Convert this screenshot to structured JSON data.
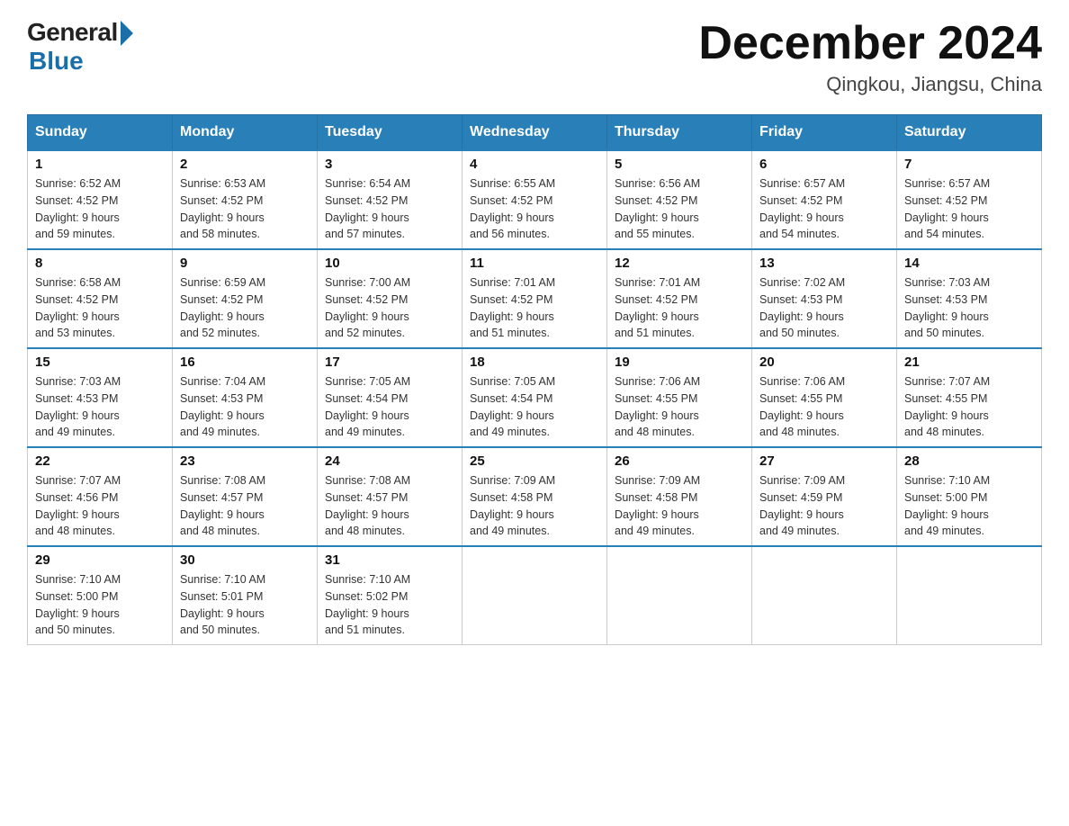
{
  "logo": {
    "general": "General",
    "blue": "Blue"
  },
  "title": "December 2024",
  "subtitle": "Qingkou, Jiangsu, China",
  "days": [
    "Sunday",
    "Monday",
    "Tuesday",
    "Wednesday",
    "Thursday",
    "Friday",
    "Saturday"
  ],
  "weeks": [
    [
      {
        "day": "1",
        "sunrise": "6:52 AM",
        "sunset": "4:52 PM",
        "daylight": "9 hours and 59 minutes."
      },
      {
        "day": "2",
        "sunrise": "6:53 AM",
        "sunset": "4:52 PM",
        "daylight": "9 hours and 58 minutes."
      },
      {
        "day": "3",
        "sunrise": "6:54 AM",
        "sunset": "4:52 PM",
        "daylight": "9 hours and 57 minutes."
      },
      {
        "day": "4",
        "sunrise": "6:55 AM",
        "sunset": "4:52 PM",
        "daylight": "9 hours and 56 minutes."
      },
      {
        "day": "5",
        "sunrise": "6:56 AM",
        "sunset": "4:52 PM",
        "daylight": "9 hours and 55 minutes."
      },
      {
        "day": "6",
        "sunrise": "6:57 AM",
        "sunset": "4:52 PM",
        "daylight": "9 hours and 54 minutes."
      },
      {
        "day": "7",
        "sunrise": "6:57 AM",
        "sunset": "4:52 PM",
        "daylight": "9 hours and 54 minutes."
      }
    ],
    [
      {
        "day": "8",
        "sunrise": "6:58 AM",
        "sunset": "4:52 PM",
        "daylight": "9 hours and 53 minutes."
      },
      {
        "day": "9",
        "sunrise": "6:59 AM",
        "sunset": "4:52 PM",
        "daylight": "9 hours and 52 minutes."
      },
      {
        "day": "10",
        "sunrise": "7:00 AM",
        "sunset": "4:52 PM",
        "daylight": "9 hours and 52 minutes."
      },
      {
        "day": "11",
        "sunrise": "7:01 AM",
        "sunset": "4:52 PM",
        "daylight": "9 hours and 51 minutes."
      },
      {
        "day": "12",
        "sunrise": "7:01 AM",
        "sunset": "4:52 PM",
        "daylight": "9 hours and 51 minutes."
      },
      {
        "day": "13",
        "sunrise": "7:02 AM",
        "sunset": "4:53 PM",
        "daylight": "9 hours and 50 minutes."
      },
      {
        "day": "14",
        "sunrise": "7:03 AM",
        "sunset": "4:53 PM",
        "daylight": "9 hours and 50 minutes."
      }
    ],
    [
      {
        "day": "15",
        "sunrise": "7:03 AM",
        "sunset": "4:53 PM",
        "daylight": "9 hours and 49 minutes."
      },
      {
        "day": "16",
        "sunrise": "7:04 AM",
        "sunset": "4:53 PM",
        "daylight": "9 hours and 49 minutes."
      },
      {
        "day": "17",
        "sunrise": "7:05 AM",
        "sunset": "4:54 PM",
        "daylight": "9 hours and 49 minutes."
      },
      {
        "day": "18",
        "sunrise": "7:05 AM",
        "sunset": "4:54 PM",
        "daylight": "9 hours and 49 minutes."
      },
      {
        "day": "19",
        "sunrise": "7:06 AM",
        "sunset": "4:55 PM",
        "daylight": "9 hours and 48 minutes."
      },
      {
        "day": "20",
        "sunrise": "7:06 AM",
        "sunset": "4:55 PM",
        "daylight": "9 hours and 48 minutes."
      },
      {
        "day": "21",
        "sunrise": "7:07 AM",
        "sunset": "4:55 PM",
        "daylight": "9 hours and 48 minutes."
      }
    ],
    [
      {
        "day": "22",
        "sunrise": "7:07 AM",
        "sunset": "4:56 PM",
        "daylight": "9 hours and 48 minutes."
      },
      {
        "day": "23",
        "sunrise": "7:08 AM",
        "sunset": "4:57 PM",
        "daylight": "9 hours and 48 minutes."
      },
      {
        "day": "24",
        "sunrise": "7:08 AM",
        "sunset": "4:57 PM",
        "daylight": "9 hours and 48 minutes."
      },
      {
        "day": "25",
        "sunrise": "7:09 AM",
        "sunset": "4:58 PM",
        "daylight": "9 hours and 49 minutes."
      },
      {
        "day": "26",
        "sunrise": "7:09 AM",
        "sunset": "4:58 PM",
        "daylight": "9 hours and 49 minutes."
      },
      {
        "day": "27",
        "sunrise": "7:09 AM",
        "sunset": "4:59 PM",
        "daylight": "9 hours and 49 minutes."
      },
      {
        "day": "28",
        "sunrise": "7:10 AM",
        "sunset": "5:00 PM",
        "daylight": "9 hours and 49 minutes."
      }
    ],
    [
      {
        "day": "29",
        "sunrise": "7:10 AM",
        "sunset": "5:00 PM",
        "daylight": "9 hours and 50 minutes."
      },
      {
        "day": "30",
        "sunrise": "7:10 AM",
        "sunset": "5:01 PM",
        "daylight": "9 hours and 50 minutes."
      },
      {
        "day": "31",
        "sunrise": "7:10 AM",
        "sunset": "5:02 PM",
        "daylight": "9 hours and 51 minutes."
      },
      null,
      null,
      null,
      null
    ]
  ],
  "labels": {
    "sunrise": "Sunrise:",
    "sunset": "Sunset:",
    "daylight": "Daylight:"
  }
}
